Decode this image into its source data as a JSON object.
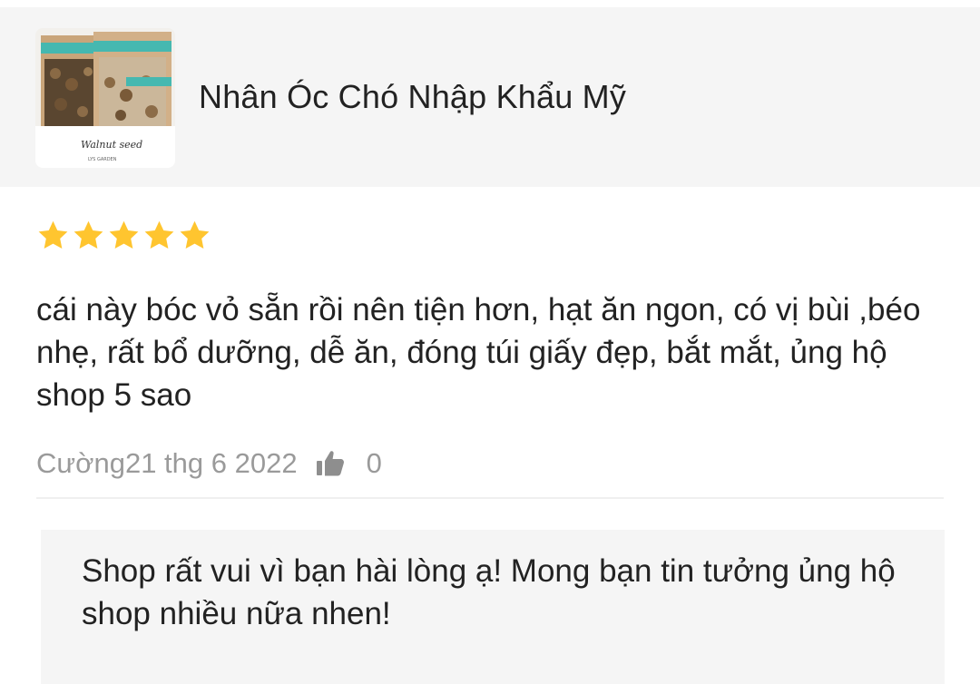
{
  "product": {
    "title": "Nhân Óc Chó Nhập Khẩu Mỹ",
    "thumbnail": {
      "text_line1": "Walnut seed",
      "text_line2": "LYS GARDEN"
    }
  },
  "review": {
    "rating": 5,
    "rating_max": 5,
    "star_color": "#FFC52F",
    "text": "cái này bóc vỏ sẵn rồi nên tiện hơn, hạt ăn ngon, có vị bùi ,béo nhẹ, rất bổ dưỡng, dễ ăn, đóng túi giấy đẹp, bắt mắt, ủng hộ shop 5 sao",
    "author_date": "Cường21 thg 6 2022",
    "like_count": "0"
  },
  "shop_reply": {
    "text": "Shop rất vui vì bạn hài lòng ạ! Mong bạn tin tưởng ủng hộ shop nhiều nữa nhen!"
  }
}
